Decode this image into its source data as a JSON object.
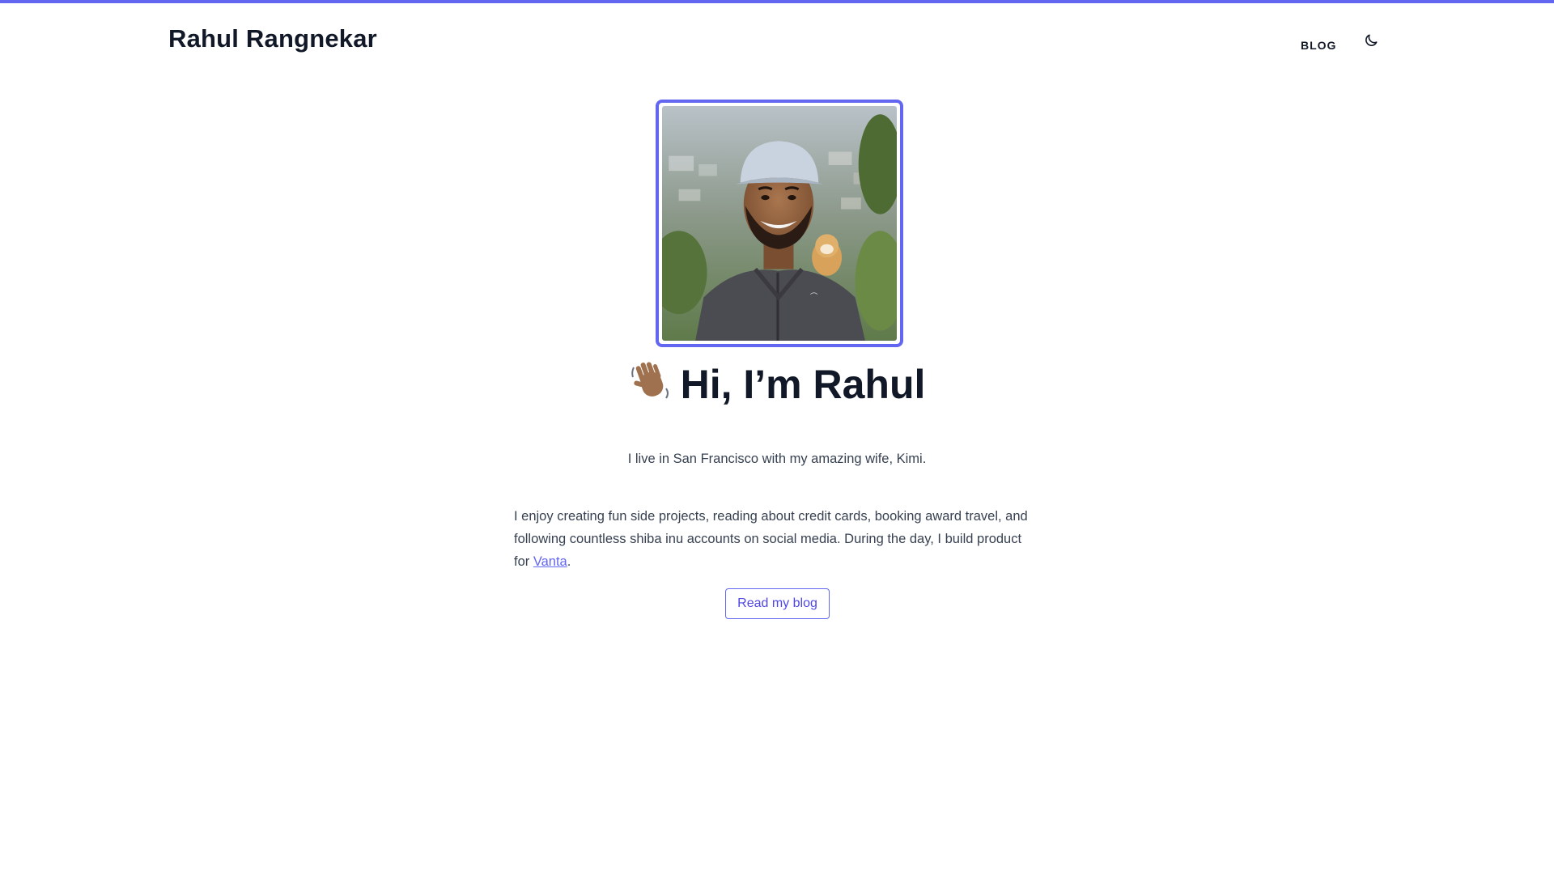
{
  "header": {
    "site_title": "Rahul Rangnekar",
    "nav_blog": "BLOG",
    "theme_toggle_icon": "moon-icon"
  },
  "hero": {
    "avatar_alt": "photo of Rahul",
    "greeting_emoji": "👋🏽",
    "greeting_icon": "waving-hand-icon",
    "greeting": "Hi, I’m Rahul",
    "intro": "I live in San Francisco with my amazing wife, Kimi.",
    "bio_prefix": "I enjoy creating fun side projects, reading about credit cards, booking award travel, and following countless shiba inu accounts on social media. During the day, I build product for ",
    "bio_link": "Vanta",
    "bio_suffix": ".",
    "cta_label": "Read my blog"
  },
  "colors": {
    "accent": "#6366f1",
    "heading": "#111827",
    "body_text": "#374151"
  }
}
